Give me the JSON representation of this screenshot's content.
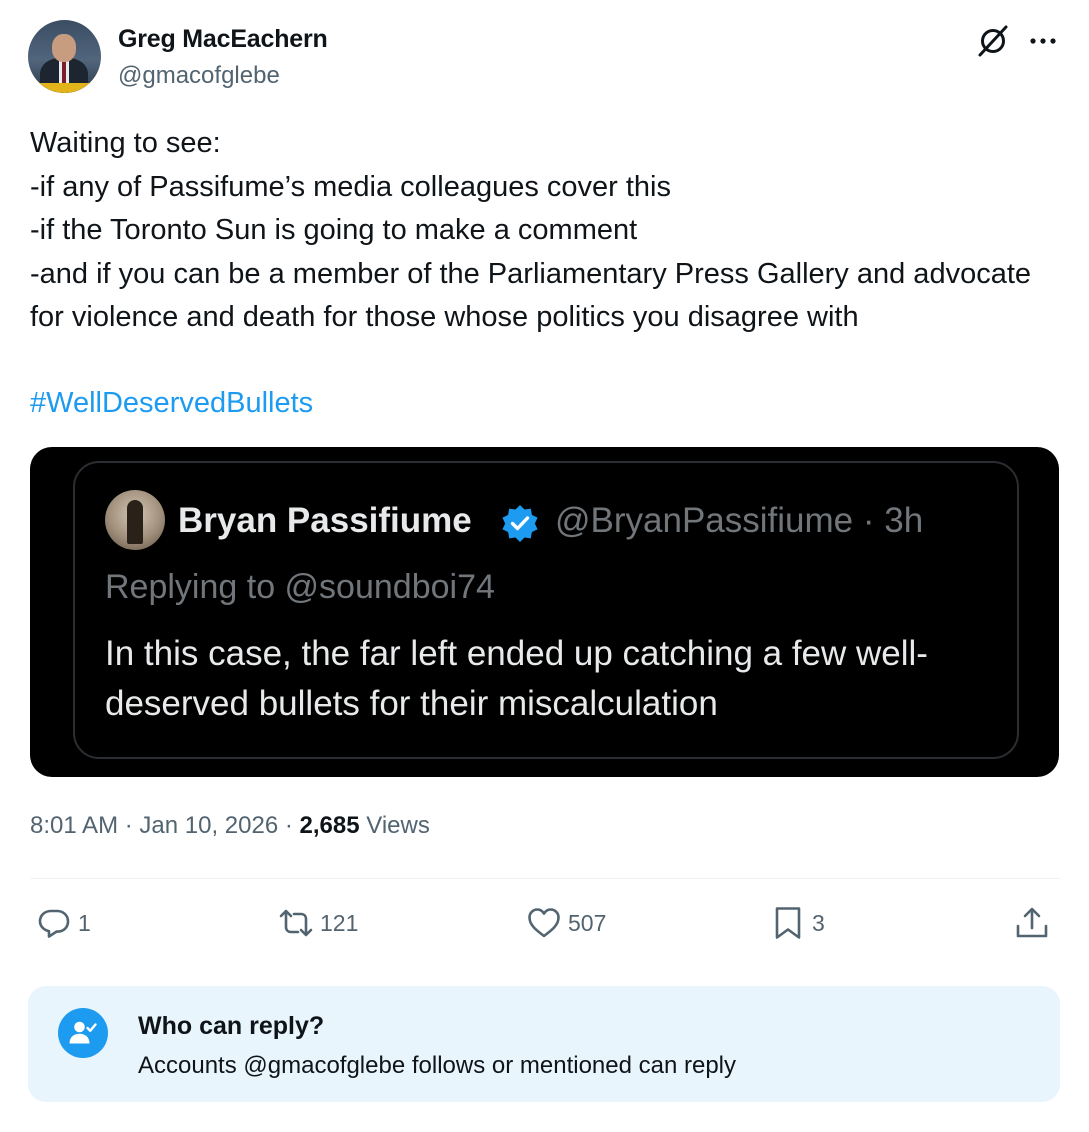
{
  "author": {
    "name": "Greg MacEachern",
    "handle": "@gmacofglebe"
  },
  "icons": {
    "grok": "grok-slash-icon",
    "more": "more-horizontal-icon"
  },
  "tweet": {
    "text": "Waiting to see:\n-if any of Passifume’s media colleagues cover this\n-if the Toronto Sun is going to make a comment\n-and if you can be a member of the Parliamentary Press Gallery and advocate for violence and death for those whose politics you disagree with",
    "hashtag": "#WellDeservedBullets"
  },
  "quoted": {
    "name": "Bryan Passifiume",
    "handle_time": "@BryanPassifiume · 3h",
    "replying_prefix": "Replying to ",
    "replying_to": "@soundboi74",
    "text": "In this case, the far left ended up catching a few well-deserved bullets for their miscalculation"
  },
  "meta": {
    "time": "8:01 AM",
    "date": "Jan 10, 2026",
    "views_count": "2,685",
    "views_label": "Views",
    "sep": " · "
  },
  "actions": {
    "replies": "1",
    "reposts": "121",
    "likes": "507",
    "bookmarks": "3"
  },
  "who_can_reply": {
    "title": "Who can reply?",
    "description": "Accounts @gmacofglebe follows or mentioned can reply"
  },
  "colors": {
    "accent": "#1d9bf0",
    "secondary_text": "#536471",
    "reply_box_bg": "#e8f5fd"
  }
}
